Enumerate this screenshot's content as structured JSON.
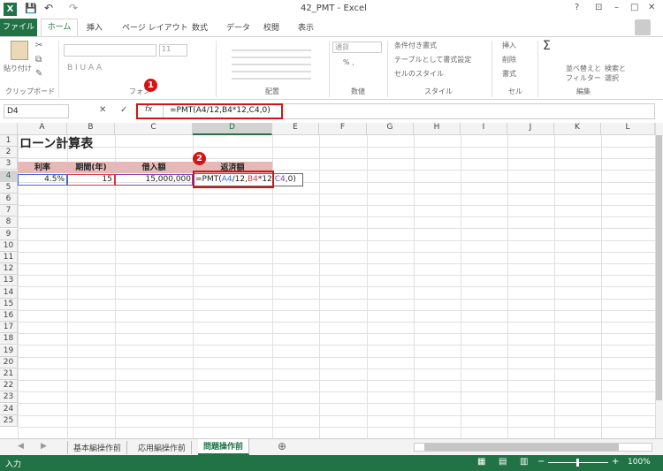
{
  "window": {
    "title": "42_PMT - Excel",
    "help": "?",
    "min": "–",
    "max": "□",
    "close": "✕"
  },
  "qat": {
    "save": "💾",
    "undo": "↶",
    "redo": "↷"
  },
  "tabs": [
    "ファイル",
    "ホーム",
    "挿入",
    "ページ レイアウト",
    "数式",
    "データ",
    "校閲",
    "表示"
  ],
  "ribbon": {
    "paste": "貼り付け",
    "clipboard": "クリップボード",
    "font_size": "11",
    "font_group": "フォン",
    "font_buttons": "B  I  U  A  A",
    "align_group": "配置",
    "num_format": "通貨",
    "num_group": "数値",
    "percent": "% ,",
    "cond_format": "条件付き書式",
    "table_format": "テーブルとして書式設定",
    "cell_style": "セルのスタイル",
    "style_group": "スタイル",
    "insert": "挿入",
    "delete": "削除",
    "format": "書式",
    "cell_group": "セル",
    "sigma": "Σ",
    "sort": "並べ替えと",
    "filter": "フィルター",
    "find": "検索と",
    "select": "選択",
    "edit_group": "編集"
  },
  "formula_bar": {
    "name_box": "D4",
    "cancel": "✕",
    "enter": "✓",
    "fx": "fx",
    "formula": "=PMT(A4/12,B4*12,C4,0)"
  },
  "columns": [
    "A",
    "B",
    "C",
    "D",
    "E",
    "F",
    "G",
    "H",
    "I",
    "J",
    "K",
    "L"
  ],
  "rows": [
    "1",
    "2",
    "3",
    "4",
    "5",
    "6",
    "7",
    "8",
    "9",
    "10",
    "11",
    "12",
    "13",
    "14",
    "15",
    "16",
    "17",
    "18",
    "19",
    "20",
    "21",
    "22",
    "23",
    "24",
    "25"
  ],
  "cells": {
    "A1": "ローン計算表",
    "A3": "利率",
    "B3": "期間(年)",
    "C3": "借入額",
    "D3": "返済額",
    "A4": "4.5%",
    "B4": "15",
    "C4": "15,000,000",
    "D4_p1": "=PMT(",
    "D4_a4": "A4",
    "D4_p2": "/12,",
    "D4_b4": "B4",
    "D4_p3": "*12,",
    "D4_c4": "C4",
    "D4_p4": ",0)"
  },
  "badges": {
    "one": "1",
    "two": "2"
  },
  "sheets": [
    "基本編操作前",
    "応用編操作前",
    "問題操作前"
  ],
  "add_sheet": "⊕",
  "status": {
    "mode": "入力",
    "zoom": "100%"
  },
  "colors": {
    "accent": "#217346",
    "header_fill": "#e6b8b7",
    "highlight": "#d41414",
    "ref_blue": "#3a6fd8",
    "ref_red": "#d63c3c",
    "ref_purple": "#8a3fb5"
  }
}
